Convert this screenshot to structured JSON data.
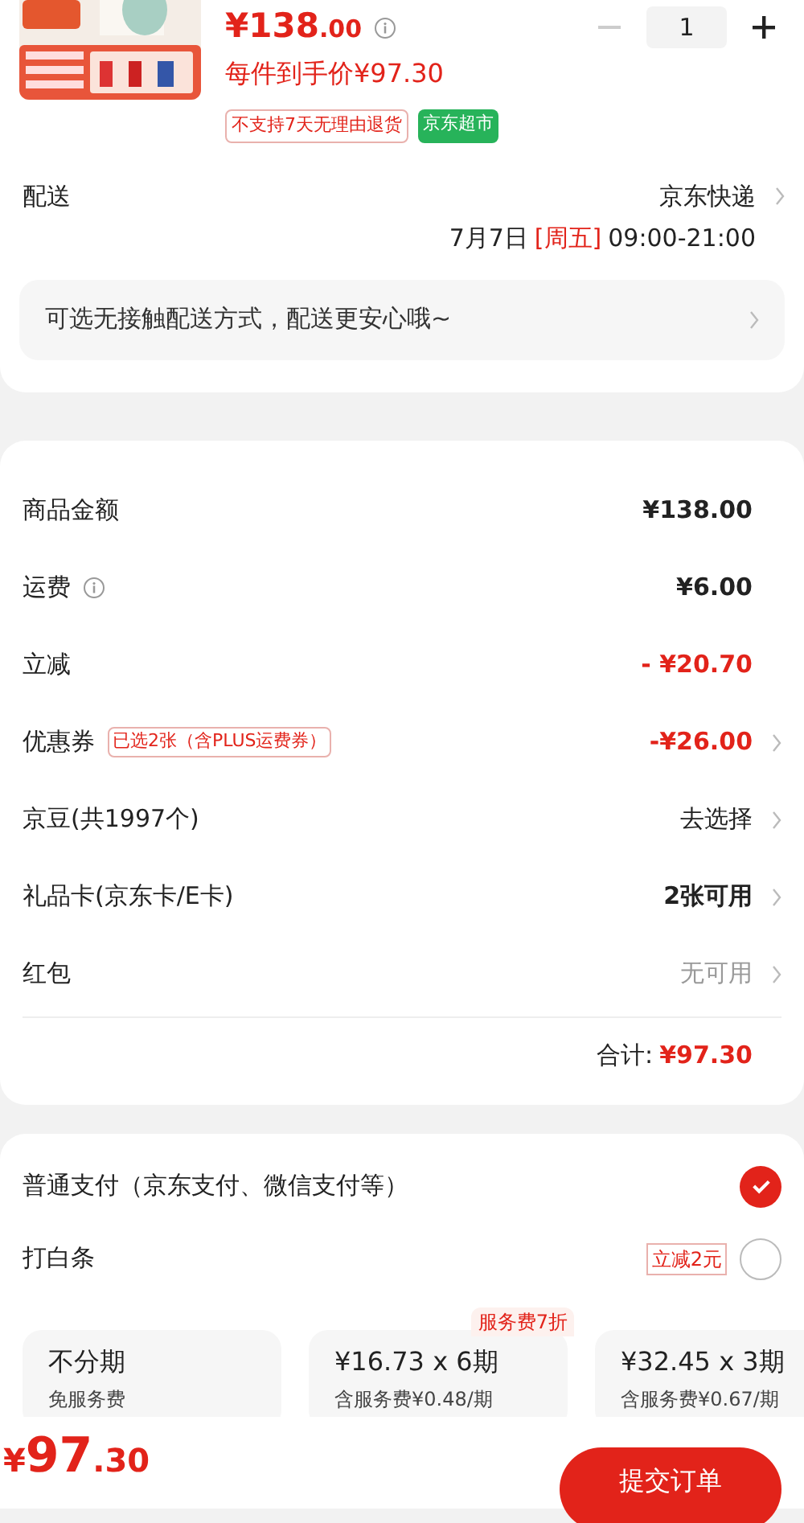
{
  "product": {
    "price_main": "¥138",
    "price_decimal": ".00",
    "quantity": "1",
    "net_price": "每件到手价¥97.30",
    "tags": [
      {
        "text": "不支持7天无理由退货",
        "kind": "outline"
      },
      {
        "text": "京东超市",
        "kind": "solid"
      }
    ]
  },
  "delivery": {
    "label": "配送",
    "method": "京东快递",
    "date": "7月7日",
    "weekday": "[周五]",
    "time": "09:00-21:00",
    "notice": "可选无接触配送方式，配送更安心哦~"
  },
  "price_rows": [
    {
      "label": "商品金额",
      "value": "¥138.00",
      "kind": "amount",
      "info": false,
      "arrow": false
    },
    {
      "label": "运费",
      "value": "¥6.00",
      "kind": "amount",
      "info": true,
      "arrow": false
    },
    {
      "label": "立减",
      "value": "- ¥20.70",
      "kind": "discount",
      "info": false,
      "arrow": false
    },
    {
      "label": "优惠券",
      "tag": "已选2张（含PLUS运费券）",
      "value": "-¥26.00",
      "kind": "discount",
      "info": false,
      "arrow": true
    },
    {
      "label": "京豆(共1997个)",
      "value": "去选择",
      "kind": "option",
      "info": false,
      "arrow": true
    },
    {
      "label": "礼品卡(京东卡/E卡)",
      "value": "2张可用",
      "kind": "amount",
      "info": false,
      "arrow": true
    },
    {
      "label": "红包",
      "value": "无可用",
      "kind": "unavailable",
      "info": false,
      "arrow": true
    }
  ],
  "total": {
    "label": "合计:",
    "value": "¥97.30"
  },
  "payment_methods": [
    {
      "label": "普通支付（京东支付、微信支付等）",
      "selected": true
    },
    {
      "label": "打白条",
      "badge": "立减2元",
      "selected": false
    }
  ],
  "installments": [
    {
      "title": "不分期",
      "subtitle": "免服务费",
      "selected": false
    },
    {
      "title": "¥16.73 x 6期",
      "subtitle": "含服务费¥0.48/期",
      "badge": "服务费7折",
      "selected": false
    },
    {
      "title": "¥32.45 x 3期",
      "subtitle": "含服务费¥0.67/期",
      "selected": false
    }
  ],
  "footer": {
    "price_main": "¥97",
    "price_decimal": ".30",
    "submit": "提交订单"
  }
}
